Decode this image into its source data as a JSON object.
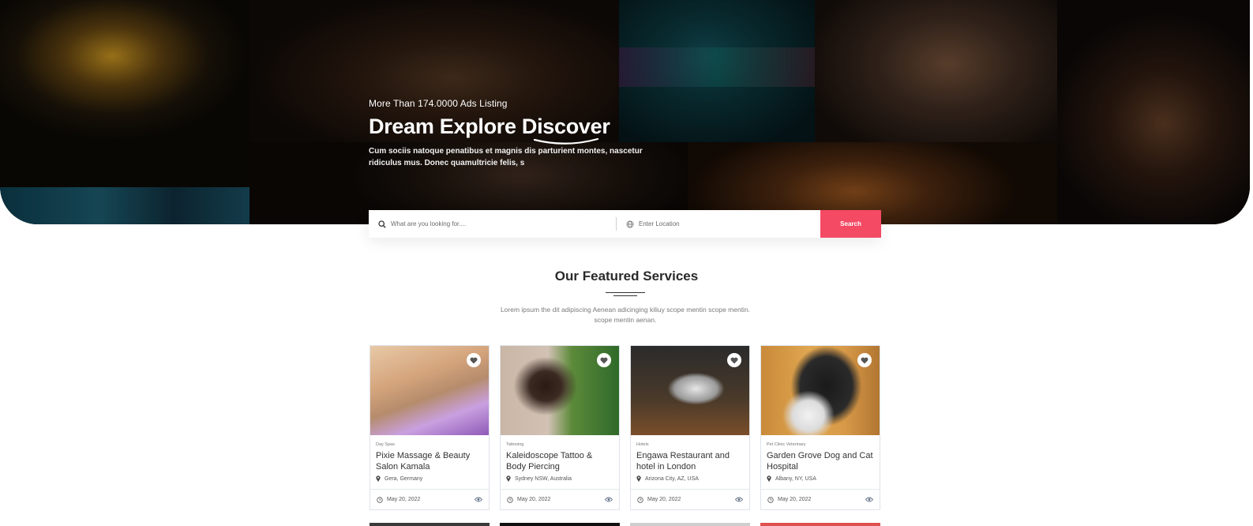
{
  "hero": {
    "eyebrow": "More Than 174.0000 Ads Listing",
    "headline": "Dream Explore Discover",
    "description": "Cum sociis natoque penatibus et magnis dis parturient montes, nascetur ridiculus mus. Donec quamultricie felis, s"
  },
  "search": {
    "what_placeholder": "What are you looking for....",
    "where_placeholder": "Enter Location",
    "button_label": "Search",
    "accent_color": "#f44a64"
  },
  "section": {
    "title": "Our Featured Services",
    "subtitle": "Lorem ipsum the dit adipiscing Aenean adicinging kiliuy scope mentin scope mentin. scope mentin aenan."
  },
  "cards": [
    {
      "category": "Day Spas",
      "title": "Pixie Massage & Beauty Salon Kamala",
      "location": "Gera, Germany",
      "date": "May 20, 2022"
    },
    {
      "category": "Tattooing",
      "title": "Kaleidoscope Tattoo & Body Piercing",
      "location": "Sydney NSW, Australia",
      "date": "May 20, 2022"
    },
    {
      "category": "Hotels",
      "title": "Engawa Restaurant and hotel in London",
      "location": "Arizona City, AZ, USA",
      "date": "May 20, 2022"
    },
    {
      "category": "Pet Clinic  Veterinary",
      "title": "Garden Grove Dog and Cat Hospital",
      "location": "Albany, NY, USA",
      "date": "May 20, 2022"
    }
  ],
  "icons": {
    "search": "search-icon",
    "location": "globe-icon",
    "favorite": "heart-icon",
    "pin": "map-pin-icon",
    "date": "clock-icon",
    "views": "eye-icon"
  }
}
